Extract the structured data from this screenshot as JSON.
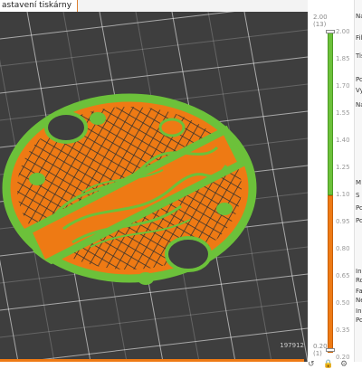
{
  "tab": {
    "title": "astavení tiskárny"
  },
  "viewport": {
    "move_count": "197912"
  },
  "layer_slider": {
    "top_height": "2.00",
    "top_layer": "(13)",
    "bottom_height": "0.20",
    "bottom_layer": "(1)",
    "ticks": [
      "2.00",
      "1.85",
      "1.70",
      "1.55",
      "1.40",
      "1.25",
      "1.10",
      "0.95",
      "0.80",
      "0.65",
      "0.50",
      "0.35",
      "0.20"
    ]
  },
  "sidebar": {
    "labels": [
      "Nas",
      "Fila",
      "Tisk",
      "Po",
      "Vyp",
      "Na",
      "M",
      "S",
      "Po",
      "Po",
      "In",
      "Ro",
      "Fa",
      "Ne",
      "In",
      "Po"
    ]
  },
  "colors": {
    "green": "#6cc13a",
    "orange": "#ee7a14",
    "bed": "#3e3e3e"
  },
  "icons": [
    "undo-icon",
    "lock-icon",
    "settings-icon"
  ]
}
